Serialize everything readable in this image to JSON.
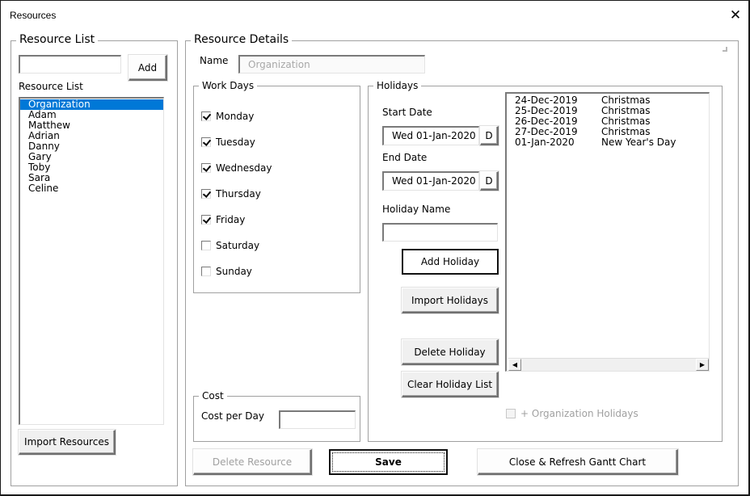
{
  "window": {
    "title": "Resources",
    "close_icon": "close-icon"
  },
  "resource_list_panel": {
    "frame_label": "Resource List",
    "new_resource_value": "",
    "add_button": "Add",
    "list_label": "Resource List",
    "items": [
      "Organization",
      "Adam",
      "Matthew",
      "Adrian",
      "Danny",
      "Gary",
      "Toby",
      "Sara",
      "Celine"
    ],
    "selected_index": 0,
    "import_button": "Import Resources"
  },
  "resource_details": {
    "frame_label": "Resource Details",
    "name_label": "Name",
    "name_value": "Organization",
    "work_days": {
      "frame_label": "Work Days",
      "days": [
        {
          "label": "Monday",
          "checked": true
        },
        {
          "label": "Tuesday",
          "checked": true
        },
        {
          "label": "Wednesday",
          "checked": true
        },
        {
          "label": "Thursday",
          "checked": true
        },
        {
          "label": "Friday",
          "checked": true
        },
        {
          "label": "Saturday",
          "checked": false
        },
        {
          "label": "Sunday",
          "checked": false
        }
      ]
    },
    "cost": {
      "frame_label": "Cost",
      "cost_per_day_label": "Cost per Day",
      "cost_per_day_value": ""
    },
    "holidays": {
      "frame_label": "Holidays",
      "start_date_label": "Start Date",
      "start_date_value": "Wed 01-Jan-2020",
      "start_date_picker": "D",
      "end_date_label": "End Date",
      "end_date_value": "Wed 01-Jan-2020",
      "end_date_picker": "D",
      "holiday_name_label": "Holiday Name",
      "holiday_name_value": "",
      "add_holiday_button": "Add Holiday",
      "import_holidays_button": "Import Holidays",
      "delete_holiday_button": "Delete Holiday",
      "clear_holiday_list_button": "Clear Holiday List",
      "list": [
        {
          "date": "24-Dec-2019",
          "name": "Christmas"
        },
        {
          "date": "25-Dec-2019",
          "name": "Christmas"
        },
        {
          "date": "26-Dec-2019",
          "name": "Christmas"
        },
        {
          "date": "27-Dec-2019",
          "name": "Christmas"
        },
        {
          "date": "01-Jan-2020",
          "name": "New Year's Day"
        }
      ],
      "org_holidays_label": "+ Organization Holidays",
      "org_holidays_checked": false
    },
    "delete_resource_button": "Delete Resource",
    "save_button": "Save",
    "close_refresh_button": "Close & Refresh Gantt Chart"
  }
}
